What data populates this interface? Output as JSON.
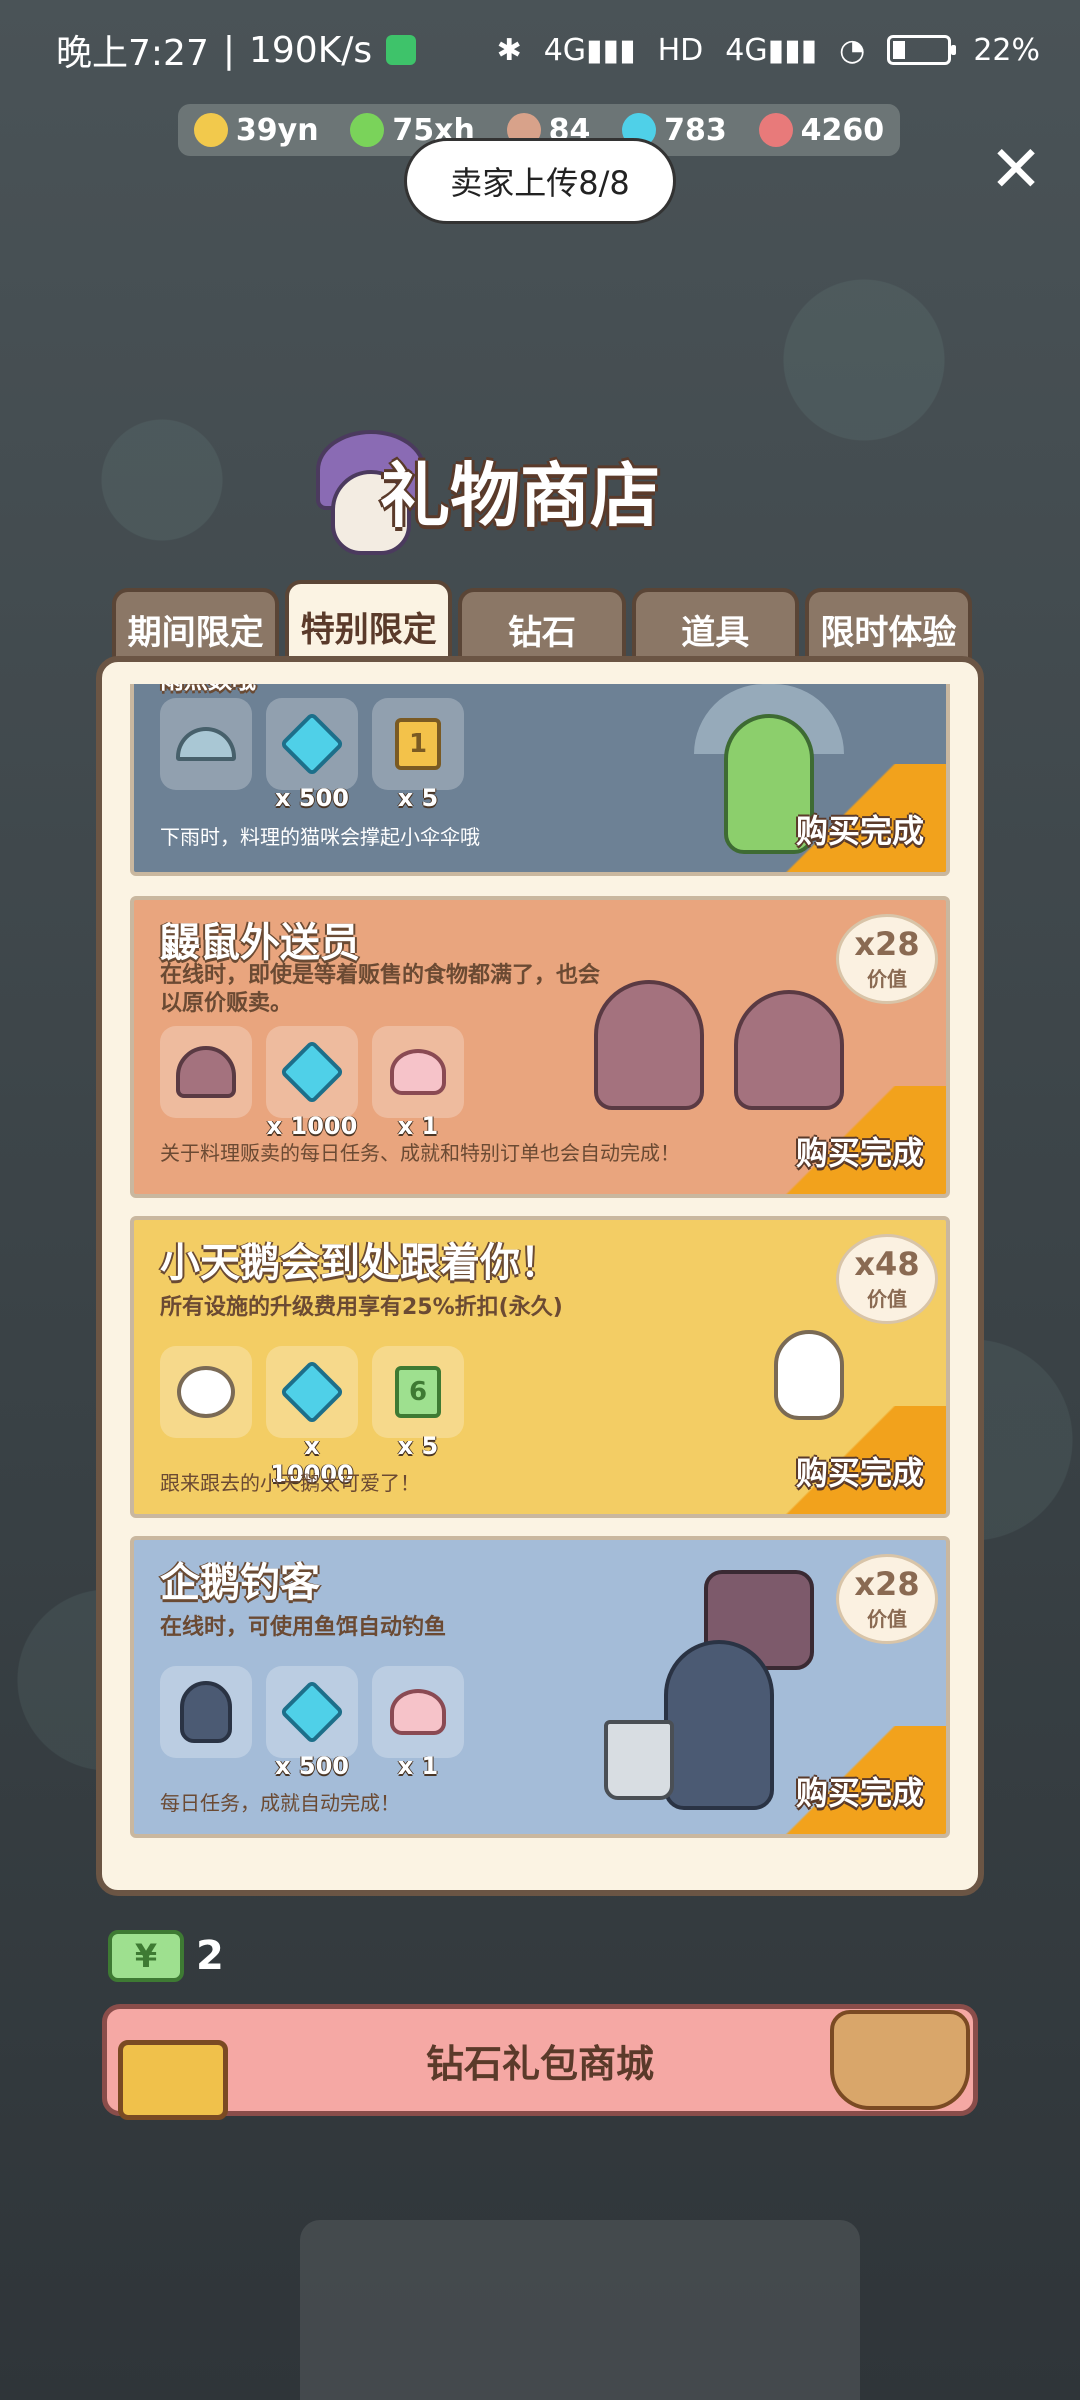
{
  "status_bar": {
    "time": "晚上7:27",
    "speed": "190K/s",
    "battery": "22%",
    "signal1": "4G",
    "signal2": "4G",
    "hd": "HD"
  },
  "resources": [
    {
      "icon": "coin-icon",
      "value": "39yn",
      "color": "#f2c94c"
    },
    {
      "icon": "lightning-icon",
      "value": "75xh",
      "color": "#7ad35a"
    },
    {
      "icon": "fish-icon",
      "value": "84",
      "color": "#d8a28a"
    },
    {
      "icon": "diamond-icon",
      "value": "783",
      "color": "#4fd0e8"
    },
    {
      "icon": "heart-icon",
      "value": "4260",
      "color": "#e87a7a"
    }
  ],
  "upload_label": "卖家上传8/8",
  "shop_title": "礼物商店",
  "tabs": [
    "期间限定",
    "特别限定",
    "钻石",
    "道具",
    "限时体验"
  ],
  "active_tab": "特别限定",
  "cards": [
    {
      "title": "雨点数哦",
      "description": "",
      "footer": "下雨时，料理的猫咪会撑起小伞伞哦",
      "items": [
        {
          "icon": "umbrella-icon",
          "qty": ""
        },
        {
          "icon": "diamond-icon",
          "qty": "x 500"
        },
        {
          "icon": "ticket-icon",
          "qty": "x 5",
          "ticket_num": "1"
        }
      ],
      "status": "购买完成",
      "color": "#6d8195"
    },
    {
      "title": "鼹鼠外送员",
      "description": "在线时，即使是等着贩售的食物都满了，也会以原价贩卖。",
      "footer": "关于料理贩卖的每日任务、成就和特别订单也会自动完成！",
      "items": [
        {
          "icon": "mole-icon",
          "qty": ""
        },
        {
          "icon": "diamond-icon",
          "qty": "x 1000"
        },
        {
          "icon": "cake-icon",
          "qty": "x 1"
        }
      ],
      "value_mult": "x28",
      "value_label": "价值",
      "status": "购买完成",
      "color": "#e9a57e"
    },
    {
      "title": "小天鹅会到处跟着你！",
      "description": "所有设施的升级费用享有25%折扣(永久)",
      "footer": "跟来跟去的小天鹅太可爱了！",
      "items": [
        {
          "icon": "duck-icon",
          "qty": ""
        },
        {
          "icon": "diamond-icon",
          "qty": "x 10000"
        },
        {
          "icon": "ticket-icon",
          "qty": "x 5",
          "ticket_num": "6"
        }
      ],
      "value_mult": "x48",
      "value_label": "价值",
      "status": "购买完成",
      "color": "#f3cd64"
    },
    {
      "title": "企鹅钓客",
      "description": "在线时，可使用鱼饵自动钓鱼",
      "footer": "每日任务，成就自动完成！",
      "items": [
        {
          "icon": "penguin-icon",
          "qty": ""
        },
        {
          "icon": "diamond-icon",
          "qty": "x 500"
        },
        {
          "icon": "cake-icon",
          "qty": "x 1"
        }
      ],
      "value_mult": "x28",
      "value_label": "价值",
      "status": "购买完成",
      "color": "#a4bcd8"
    }
  ],
  "ticket_count": "2",
  "ticket_symbol": "¥",
  "store_button": "钻石礼包商城"
}
